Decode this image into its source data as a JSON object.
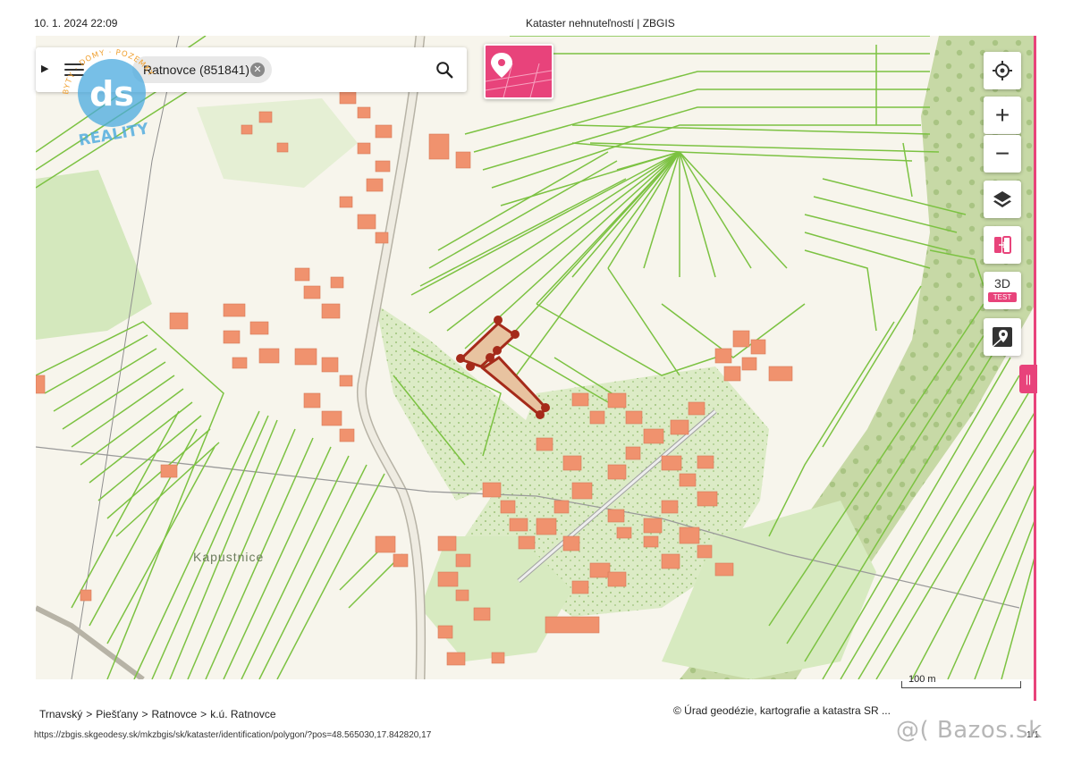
{
  "print_header": {
    "datetime": "10. 1. 2024 22:09",
    "title": "Kataster nehnuteľností | ZBGIS"
  },
  "search": {
    "chip_label": "Ratnovce (851841)",
    "close_icon": "close-circle-icon",
    "menu_icon": "hamburger-menu-icon",
    "search_icon": "magnifier-icon"
  },
  "cadastre_button": {
    "icon": "location-pin-parcel-icon"
  },
  "map_controls": {
    "locate_icon": "crosshair-icon",
    "zoom_in": "+",
    "zoom_out": "−",
    "layers_icon": "layers-icon",
    "compare_icon": "split-view-icon",
    "mode_3d": "3D",
    "mode_3d_badge": "TEST",
    "streetview_icon": "google-maps-icon",
    "side_tab_icon": "drag-handle-icon"
  },
  "map": {
    "place_label": "Kapustnice",
    "scale_label": "100 m",
    "colors": {
      "parcel_line": "#7cc242",
      "building": "#f0926e",
      "selected_parcel": "#a52a1a",
      "accent": "#e8437b"
    }
  },
  "breadcrumb": [
    "Trnavský",
    "Piešťany",
    "Ratnovce",
    "k.ú. Ratnovce"
  ],
  "breadcrumb_sep": ">",
  "copyright": "© Úrad geodézie, kartografie a katastra SR ...",
  "footer": {
    "url": "https://zbgis.skgeodesy.sk/mkzbgis/sk/kataster/identification/polygon/?pos=48.565030,17.842820,17",
    "page": "1/1"
  },
  "overlay_logo": {
    "initials": "ds",
    "text_top": "BYTY · DOMY · POZEMKY",
    "text_bottom": "REALITY"
  },
  "watermark": "@( Bazos.sk"
}
